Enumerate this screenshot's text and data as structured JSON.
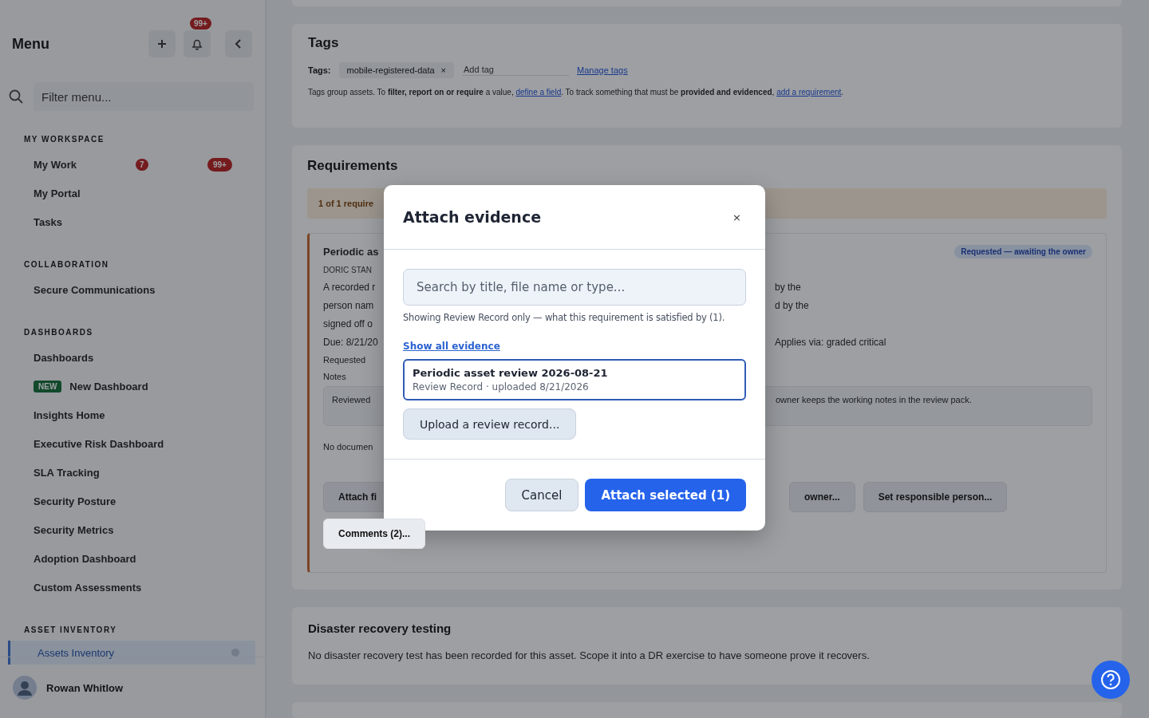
{
  "sidebar": {
    "title": "Menu",
    "notification_badge": "99+",
    "filter": {
      "placeholder": "Filter menu..."
    },
    "sections": [
      {
        "heading": "MY WORKSPACE",
        "items": [
          {
            "label": "My Work",
            "selected": false,
            "counts": [
              "7",
              "99+"
            ]
          },
          {
            "label": "My Portal",
            "selected": false
          },
          {
            "label": "Tasks",
            "selected": false
          }
        ]
      },
      {
        "heading": "COLLABORATION",
        "items": [
          {
            "label": "Secure Communications",
            "selected": false
          }
        ]
      },
      {
        "heading": "DASHBOARDS",
        "items": [
          {
            "label": "Dashboards",
            "selected": false
          },
          {
            "label": "New Dashboard",
            "selected": false,
            "tag": "NEW"
          },
          {
            "label": "Insights Home",
            "selected": false
          },
          {
            "label": "Executive Risk Dashboard",
            "selected": false
          },
          {
            "label": "SLA Tracking",
            "selected": false
          },
          {
            "label": "Security Posture",
            "selected": false
          },
          {
            "label": "Security Metrics",
            "selected": false
          },
          {
            "label": "Adoption Dashboard",
            "selected": false
          },
          {
            "label": "Custom Assessments",
            "selected": false
          }
        ]
      },
      {
        "heading": "ASSET INVENTORY",
        "items": [
          {
            "label": "Assets Inventory",
            "selected": true
          }
        ]
      }
    ],
    "user": {
      "name": "Rowan Whitlow"
    }
  },
  "tags_card": {
    "title": "Tags",
    "label": "Tags:",
    "tags": [
      {
        "label": "mobile-registered-data",
        "remove": "×"
      }
    ],
    "add_tag": {
      "placeholder": "Add tag"
    },
    "manage_link": "Manage tags",
    "help": [
      {
        "kind": "text",
        "text": "Tags group assets. To "
      },
      {
        "kind": "bold",
        "text": "filter, report on or require"
      },
      {
        "kind": "text",
        "text": " a value, "
      },
      {
        "kind": "link",
        "text": "define a field"
      },
      {
        "kind": "text",
        "text": ". To track something that must be "
      },
      {
        "kind": "bold",
        "text": "provided and evidenced"
      },
      {
        "kind": "text",
        "text": ", "
      },
      {
        "kind": "link",
        "text": "add a requirement"
      },
      {
        "kind": "text",
        "text": "."
      }
    ]
  },
  "requirements": {
    "title": "Requirements",
    "banner": "1 of 1 require",
    "card": {
      "title": "Periodic as",
      "code": "DORIC STAN",
      "status": "Requested — awaiting the owner",
      "rows": [
        {
          "left": "A recorded r",
          "right": "by the"
        },
        {
          "left": "person nam",
          "right": "d by the"
        },
        {
          "left": "signed off o",
          "right": ""
        },
        {
          "left": "Due: 8/21/20",
          "right": "Applies via: graded critical"
        }
      ],
      "requested": "Requested",
      "notes_label": "Notes",
      "notes_left": "Reviewed",
      "notes_right": "owner keeps the working notes in the review pack.",
      "no_docs": "No documen",
      "buttons_left": [
        "Attach fi"
      ],
      "buttons_right": [
        "owner...",
        "Set responsible person..."
      ],
      "comments": "Comments (2)..."
    }
  },
  "dr_card": {
    "title": "Disaster recovery testing",
    "text": "No disaster recovery test has been recorded for this asset. Scope it into a DR exercise to have someone prove it recovers."
  },
  "dialog": {
    "title": "Attach evidence",
    "close": "×",
    "search": {
      "placeholder": "Search by title, file name or type..."
    },
    "hint": "Showing Review Record only — what this requirement is satisfied by (1).",
    "show_all": "Show all evidence",
    "items": [
      {
        "title": "Periodic asset review 2026-08-21",
        "meta": "Review Record · uploaded 8/21/2026",
        "selected": true
      }
    ],
    "upload": "Upload a review record...",
    "cancel": "Cancel",
    "attach": "Attach selected (1)"
  }
}
